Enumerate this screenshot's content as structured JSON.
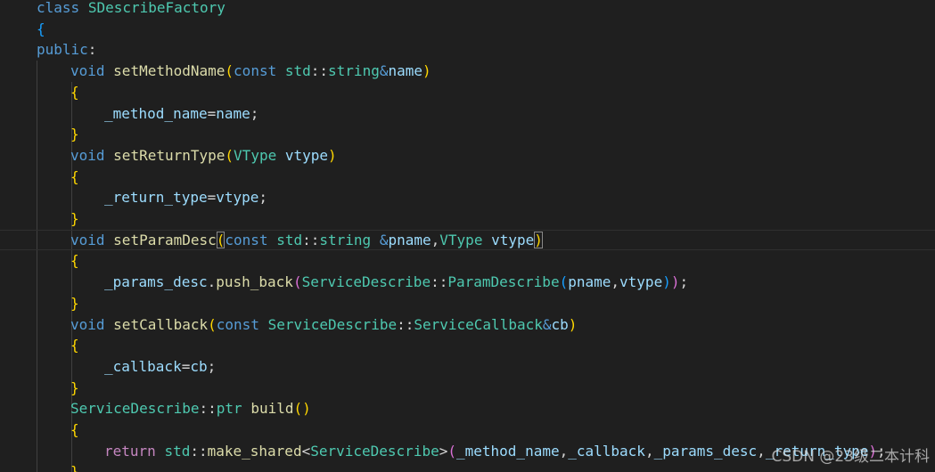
{
  "theme": {
    "background": "#1f1f1f",
    "keyword": "#569cd6",
    "control_keyword": "#c586c0",
    "type": "#4ec9b0",
    "function": "#dcdcaa",
    "variable": "#9cdcfe",
    "text": "#d4d4d4",
    "bracket_level_1": "#ffd700",
    "bracket_level_2": "#da70d6",
    "bracket_level_3": "#179fff"
  },
  "lines": [
    {
      "indent": 1,
      "tokens": [
        {
          "t": "class",
          "c": "kw"
        },
        {
          "t": " "
        },
        {
          "t": "SDescribeFactory",
          "c": "type"
        }
      ]
    },
    {
      "indent": 1,
      "tokens": [
        {
          "t": "{",
          "c": "b3"
        }
      ]
    },
    {
      "indent": 1,
      "tokens": [
        {
          "t": "public",
          "c": "kw"
        },
        {
          "t": ":"
        }
      ]
    },
    {
      "indent": 2,
      "tokens": [
        {
          "t": "void",
          "c": "kw"
        },
        {
          "t": " "
        },
        {
          "t": "setMethodName",
          "c": "func"
        },
        {
          "t": "(",
          "c": "b1"
        },
        {
          "t": "const",
          "c": "kw"
        },
        {
          "t": " "
        },
        {
          "t": "std",
          "c": "type"
        },
        {
          "t": "::"
        },
        {
          "t": "string",
          "c": "type"
        },
        {
          "t": "&",
          "c": "kw"
        },
        {
          "t": "name",
          "c": "var"
        },
        {
          "t": ")",
          "c": "b1"
        }
      ]
    },
    {
      "indent": 2,
      "tokens": [
        {
          "t": "{",
          "c": "b1"
        }
      ]
    },
    {
      "indent": 3,
      "tokens": [
        {
          "t": "_method_name",
          "c": "var"
        },
        {
          "t": "="
        },
        {
          "t": "name",
          "c": "var"
        },
        {
          "t": ";"
        }
      ]
    },
    {
      "indent": 2,
      "tokens": [
        {
          "t": "}",
          "c": "b1"
        }
      ]
    },
    {
      "indent": 2,
      "tokens": [
        {
          "t": "void",
          "c": "kw"
        },
        {
          "t": " "
        },
        {
          "t": "setReturnType",
          "c": "func"
        },
        {
          "t": "(",
          "c": "b1"
        },
        {
          "t": "VType",
          "c": "type"
        },
        {
          "t": " "
        },
        {
          "t": "vtype",
          "c": "var"
        },
        {
          "t": ")",
          "c": "b1"
        }
      ]
    },
    {
      "indent": 2,
      "tokens": [
        {
          "t": "{",
          "c": "b1"
        }
      ]
    },
    {
      "indent": 3,
      "tokens": [
        {
          "t": "_return_type",
          "c": "var"
        },
        {
          "t": "="
        },
        {
          "t": "vtype",
          "c": "var"
        },
        {
          "t": ";"
        }
      ]
    },
    {
      "indent": 2,
      "tokens": [
        {
          "t": "}",
          "c": "b1"
        }
      ]
    },
    {
      "indent": 2,
      "current": true,
      "tokens": [
        {
          "t": "void",
          "c": "kw"
        },
        {
          "t": " "
        },
        {
          "t": "setParamDesc",
          "c": "func"
        },
        {
          "t": "(",
          "c": "b1 match"
        },
        {
          "t": "const",
          "c": "kw"
        },
        {
          "t": " "
        },
        {
          "t": "std",
          "c": "type"
        },
        {
          "t": "::"
        },
        {
          "t": "string",
          "c": "type"
        },
        {
          "t": " "
        },
        {
          "t": "&",
          "c": "kw"
        },
        {
          "t": "pname",
          "c": "var"
        },
        {
          "t": ","
        },
        {
          "t": "VType",
          "c": "type"
        },
        {
          "t": " "
        },
        {
          "t": "vtype",
          "c": "var"
        },
        {
          "t": ")",
          "c": "b1 match"
        }
      ]
    },
    {
      "indent": 2,
      "tokens": [
        {
          "t": "{",
          "c": "b1"
        }
      ]
    },
    {
      "indent": 3,
      "tokens": [
        {
          "t": "_params_desc",
          "c": "var"
        },
        {
          "t": "."
        },
        {
          "t": "push_back",
          "c": "func"
        },
        {
          "t": "(",
          "c": "b2"
        },
        {
          "t": "ServiceDescribe",
          "c": "type"
        },
        {
          "t": "::"
        },
        {
          "t": "ParamDescribe",
          "c": "type"
        },
        {
          "t": "(",
          "c": "b3"
        },
        {
          "t": "pname",
          "c": "var"
        },
        {
          "t": ","
        },
        {
          "t": "vtype",
          "c": "var"
        },
        {
          "t": ")",
          "c": "b3"
        },
        {
          "t": ")",
          "c": "b2"
        },
        {
          "t": ";"
        }
      ]
    },
    {
      "indent": 2,
      "tokens": [
        {
          "t": "}",
          "c": "b1"
        }
      ]
    },
    {
      "indent": 2,
      "tokens": [
        {
          "t": "void",
          "c": "kw"
        },
        {
          "t": " "
        },
        {
          "t": "setCallback",
          "c": "func"
        },
        {
          "t": "(",
          "c": "b1"
        },
        {
          "t": "const",
          "c": "kw"
        },
        {
          "t": " "
        },
        {
          "t": "ServiceDescribe",
          "c": "type"
        },
        {
          "t": "::"
        },
        {
          "t": "ServiceCallback",
          "c": "type"
        },
        {
          "t": "&",
          "c": "kw"
        },
        {
          "t": "cb",
          "c": "var"
        },
        {
          "t": ")",
          "c": "b1"
        }
      ]
    },
    {
      "indent": 2,
      "tokens": [
        {
          "t": "{",
          "c": "b1"
        }
      ]
    },
    {
      "indent": 3,
      "tokens": [
        {
          "t": "_callback",
          "c": "var"
        },
        {
          "t": "="
        },
        {
          "t": "cb",
          "c": "var"
        },
        {
          "t": ";"
        }
      ]
    },
    {
      "indent": 2,
      "tokens": [
        {
          "t": "}",
          "c": "b1"
        }
      ]
    },
    {
      "indent": 2,
      "tokens": [
        {
          "t": "ServiceDescribe",
          "c": "type"
        },
        {
          "t": "::"
        },
        {
          "t": "ptr",
          "c": "type"
        },
        {
          "t": " "
        },
        {
          "t": "build",
          "c": "func"
        },
        {
          "t": "()",
          "c": "b1"
        }
      ]
    },
    {
      "indent": 2,
      "tokens": [
        {
          "t": "{",
          "c": "b1"
        }
      ]
    },
    {
      "indent": 3,
      "tokens": [
        {
          "t": "return",
          "c": "ctrl"
        },
        {
          "t": " "
        },
        {
          "t": "std",
          "c": "type"
        },
        {
          "t": "::"
        },
        {
          "t": "make_shared",
          "c": "func"
        },
        {
          "t": "<"
        },
        {
          "t": "ServiceDescribe",
          "c": "type"
        },
        {
          "t": ">"
        },
        {
          "t": "(",
          "c": "b2"
        },
        {
          "t": "_method_name",
          "c": "var"
        },
        {
          "t": ","
        },
        {
          "t": "_callback",
          "c": "var"
        },
        {
          "t": ","
        },
        {
          "t": "_params_desc",
          "c": "var"
        },
        {
          "t": ","
        },
        {
          "t": "_return_type",
          "c": "var"
        },
        {
          "t": ")",
          "c": "b2"
        },
        {
          "t": ";"
        }
      ]
    },
    {
      "indent": 2,
      "tokens": [
        {
          "t": "}",
          "c": "b1"
        }
      ]
    }
  ],
  "watermark": "CSDN @23级二本计科"
}
